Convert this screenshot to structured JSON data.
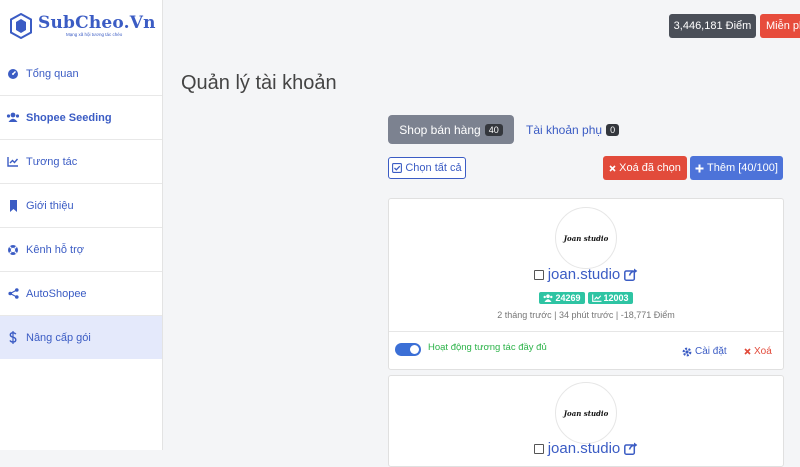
{
  "brand": {
    "name": "SubCheo.Vn",
    "tagline": "Mạng xã hội tương tác chéo"
  },
  "sidebar": {
    "items": [
      {
        "label": "Tổng quan",
        "icon": "gauge-icon"
      },
      {
        "label": "Shopee Seeding",
        "icon": "users-icon"
      },
      {
        "label": "Tương tác",
        "icon": "chart-line-icon"
      },
      {
        "label": "Giới thiệu",
        "icon": "bookmark-icon"
      },
      {
        "label": "Kênh hỗ trợ",
        "icon": "lifebuoy-icon"
      },
      {
        "label": "AutoShopee",
        "icon": "share-icon"
      },
      {
        "label": "Nâng cấp gói",
        "icon": "dollar-icon"
      }
    ]
  },
  "header": {
    "points": "3,446,181 Điểm",
    "free_label": "Miễn phí"
  },
  "page": {
    "title": "Quản lý tài khoản"
  },
  "tabs": {
    "shop": {
      "label": "Shop bán hàng",
      "count": "40"
    },
    "sub": {
      "label": "Tài khoản phụ",
      "count": "0"
    }
  },
  "actions": {
    "select_all": "Chọn tất cả",
    "delete_selected": "Xoá đã chọn",
    "add": "Thêm [40/100]"
  },
  "accounts": [
    {
      "avatar_text": "Joan studio",
      "name": "joan.studio",
      "followers": "24269",
      "rating": "12003",
      "meta": "2 tháng trước | 34 phút trước | -18,771 Điểm",
      "toggle_label": "Hoạt động tương tác đầy đủ",
      "settings_label": "Cài đặt",
      "delete_label": "Xoá"
    },
    {
      "avatar_text": "Joan studio",
      "name": "joan.studio"
    }
  ],
  "colors": {
    "accent": "#3b5cc4",
    "danger": "#e24b3b",
    "success": "#2ec4a3"
  }
}
